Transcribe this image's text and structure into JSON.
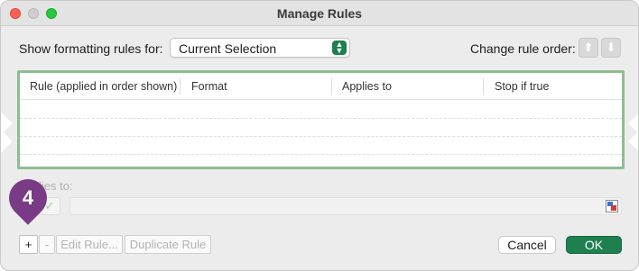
{
  "window": {
    "title": "Manage Rules"
  },
  "filter": {
    "label": "Show formatting rules for:",
    "selected": "Current Selection"
  },
  "order": {
    "label": "Change rule order:",
    "up_icon": "arrow-up-icon",
    "down_icon": "arrow-down-icon"
  },
  "rules_table": {
    "columns": [
      "Rule (applied in order shown)",
      "Format",
      "Applies to",
      "Stop if true"
    ],
    "rows": []
  },
  "applies": {
    "label": "lies to:",
    "value": ""
  },
  "rule_buttons": {
    "add": "+",
    "remove": "-",
    "edit": "Edit Rule...",
    "duplicate": "Duplicate Rule"
  },
  "dialog_buttons": {
    "cancel": "Cancel",
    "ok": "OK"
  },
  "callout": {
    "number": "4",
    "color": "#7a3b86"
  },
  "colors": {
    "accent": "#1e7f4f",
    "table_border": "#8fbd93"
  }
}
